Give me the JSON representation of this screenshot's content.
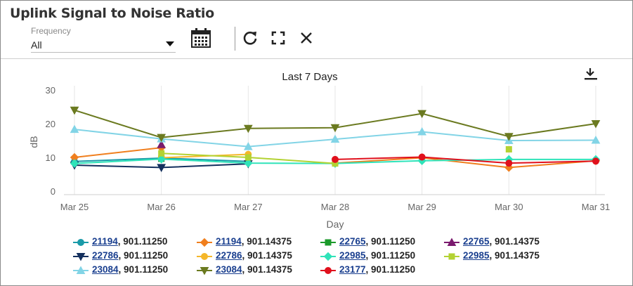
{
  "widget": {
    "title": "Uplink Signal to Noise Ratio",
    "frequency_label": "Frequency",
    "frequency_value": "All",
    "toolbar_icons": [
      "calendar-icon",
      "refresh-icon",
      "expand-icon",
      "close-icon"
    ],
    "download_icon": "download-icon"
  },
  "chart_data": {
    "type": "line",
    "title": "Last 7 Days",
    "xlabel": "Day",
    "ylabel": "dB",
    "categories": [
      "Mar 25",
      "Mar 26",
      "Mar 27",
      "Mar 28",
      "Mar 29",
      "Mar 30",
      "Mar 31"
    ],
    "yticks": [
      0,
      10,
      20,
      30
    ],
    "ylim": [
      0,
      30
    ],
    "grid": "vertical",
    "legend_position": "bottom",
    "series": [
      {
        "name": "21194, 901.11250",
        "id": "21194",
        "freq": "901.11250",
        "color": "#1a9aa8",
        "marker": "circle",
        "values": [
          8.8,
          9.8,
          8.8,
          null,
          null,
          null,
          null
        ]
      },
      {
        "name": "21194, 901.14375",
        "id": "21194",
        "freq": "901.14375",
        "color": "#f07f1e",
        "marker": "diamond",
        "values": [
          10.0,
          12.9,
          null,
          8.3,
          9.9,
          7.0,
          9.0
        ]
      },
      {
        "name": "22765, 901.11250",
        "id": "22765",
        "freq": "901.11250",
        "color": "#1b9a2a",
        "marker": "square",
        "values": [
          null,
          9.6,
          null,
          null,
          null,
          null,
          null
        ]
      },
      {
        "name": "22765, 901.14375",
        "id": "22765",
        "freq": "901.14375",
        "color": "#7a1a6e",
        "marker": "triangle",
        "values": [
          null,
          13.8,
          null,
          null,
          null,
          null,
          null
        ]
      },
      {
        "name": "22786, 901.11250",
        "id": "22786",
        "freq": "901.11250",
        "color": "#14305e",
        "marker": "triangle-down",
        "values": [
          7.7,
          7.0,
          8.1,
          null,
          null,
          null,
          null
        ]
      },
      {
        "name": "22786, 901.14375",
        "id": "22786",
        "freq": "901.14375",
        "color": "#f5b72a",
        "marker": "circle",
        "values": [
          null,
          9.9,
          10.9,
          null,
          null,
          null,
          null
        ]
      },
      {
        "name": "22985, 901.11250",
        "id": "22985",
        "freq": "901.11250",
        "color": "#2fe3b9",
        "marker": "diamond",
        "values": [
          8.2,
          9.5,
          8.3,
          8.2,
          9.0,
          9.4,
          9.4
        ]
      },
      {
        "name": "22985, 901.14375",
        "id": "22985",
        "freq": "901.14375",
        "color": "#b3d233",
        "marker": "square",
        "values": [
          null,
          11.2,
          10.0,
          8.2,
          null,
          12.4,
          null
        ]
      },
      {
        "name": "23084, 901.11250",
        "id": "23084",
        "freq": "901.11250",
        "color": "#82d4e6",
        "marker": "triangle",
        "values": [
          18.3,
          15.5,
          13.2,
          15.4,
          17.6,
          15.0,
          15.1
        ]
      },
      {
        "name": "23084, 901.14375",
        "id": "23084",
        "freq": "901.14375",
        "color": "#6b7a20",
        "marker": "triangle-down",
        "values": [
          24.0,
          15.9,
          18.6,
          18.8,
          23.0,
          16.2,
          20.0
        ]
      },
      {
        "name": "23177, 901.11250",
        "id": "23177",
        "freq": "901.11250",
        "color": "#e0101c",
        "marker": "circle",
        "values": [
          null,
          null,
          null,
          9.4,
          10.1,
          8.3,
          8.9
        ]
      }
    ]
  }
}
